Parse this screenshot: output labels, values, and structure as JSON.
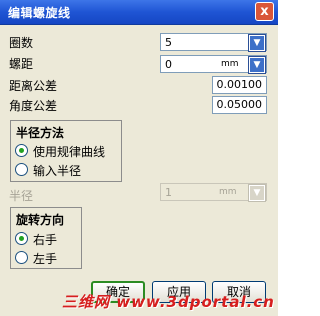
{
  "window": {
    "title": "编辑螺旋线",
    "close_glyph": "x"
  },
  "fields": {
    "turns": {
      "label": "圈数",
      "value": "5"
    },
    "pitch": {
      "label": "螺距",
      "value": "0",
      "unit": "mm"
    },
    "distance_tolerance": {
      "label": "距离公差",
      "value": "0.00100"
    },
    "angle_tolerance": {
      "label": "角度公差",
      "value": "0.05000"
    }
  },
  "radius_method": {
    "title": "半径方法",
    "options": [
      {
        "label": "使用规律曲线",
        "selected": true
      },
      {
        "label": "输入半径",
        "selected": false
      }
    ]
  },
  "radius": {
    "label": "半径",
    "value": "1",
    "unit": "mm",
    "enabled": false
  },
  "rotation": {
    "title": "旋转方向",
    "options": [
      {
        "label": "右手",
        "selected": true
      },
      {
        "label": "左手",
        "selected": false
      }
    ]
  },
  "buttons": {
    "ok": "确定",
    "apply": "应用",
    "cancel": "取消"
  },
  "watermark": "三维网 www.3dportal.cn",
  "icons": {
    "spinner": "down-arrow-icon"
  },
  "colors": {
    "titlebar": "#1f55d4",
    "dialog_bg": "#ece9d8",
    "spin": "#3d70c8",
    "watermark": "#d61e1e"
  }
}
